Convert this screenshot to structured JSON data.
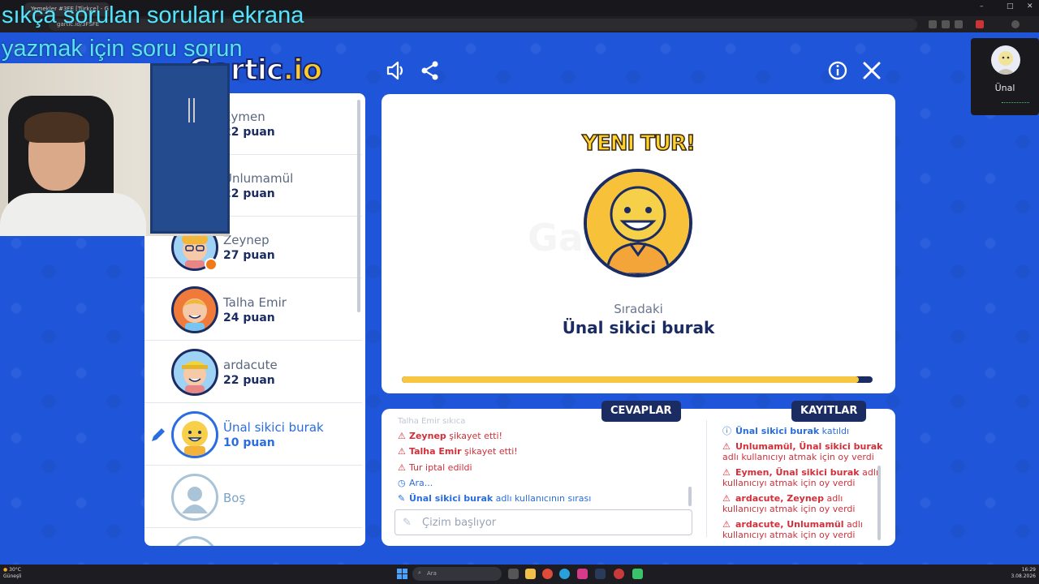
{
  "browser": {
    "tab_title": "Yemekler #3FE [Türkçe] - G",
    "address": "gartic.io/3FSFE"
  },
  "overlay": {
    "line1": "sıkça sorulan soruları ekrana",
    "line2": "yazmak  için soru sorun"
  },
  "logo": {
    "main": "Gartic",
    "suffix": ".io"
  },
  "players": [
    {
      "name": "Eymen",
      "score": "22 puan",
      "state": "normal"
    },
    {
      "name": "Unlumamül",
      "score": "22 puan",
      "state": "normal"
    },
    {
      "name": "Zeynep",
      "score": "27 puan",
      "state": "normal"
    },
    {
      "name": "Talha Emir",
      "score": "24 puan",
      "state": "normal"
    },
    {
      "name": "ardacute",
      "score": "22 puan",
      "state": "normal"
    },
    {
      "name": "Ünal sikici burak",
      "score": "10 puan",
      "state": "active"
    },
    {
      "name": "Boş",
      "score": "",
      "state": "empty"
    }
  ],
  "round": {
    "banner": "YENI TUR!",
    "next_label": "Sıradaki",
    "next_player": "Ünal sikici burak",
    "progress": 0.97
  },
  "tabs": {
    "answers": "CEVAPLAR",
    "logs": "KAYITLAR"
  },
  "answers": {
    "partial_top": "Talha Emir sıkıca",
    "messages": [
      {
        "icon": "warning-icon",
        "who": "Zeynep",
        "text": " şikayet etti!",
        "color": "red"
      },
      {
        "icon": "warning-icon",
        "who": "Talha Emir",
        "text": " şikayet etti!",
        "color": "red"
      },
      {
        "icon": "warning-icon",
        "who": "",
        "text": "Tur iptal edildi",
        "color": "red"
      },
      {
        "icon": "clock-icon",
        "who": "",
        "text": "Ara...",
        "color": "blue"
      },
      {
        "icon": "pencil-icon",
        "who": "Ünal sikici burak",
        "text": " adlı kullanıcının sırası",
        "color": "blue"
      }
    ],
    "input_placeholder": "Çizim başlıyor"
  },
  "logs": [
    {
      "icon": "info-icon",
      "who": "Ünal sikici burak",
      "text": " katıldı",
      "line2": "",
      "color": "blue"
    },
    {
      "icon": "warning-icon",
      "who": "Unlumamül, Ünal sikici burak",
      "text": "",
      "line2": "adlı kullanıcıyı atmak için oy verdi",
      "color": "red"
    },
    {
      "icon": "warning-icon",
      "who": "Eymen, Ünal sikici burak",
      "text": " adlı",
      "line2": "kullanıcıyı atmak için oy verdi",
      "color": "red"
    },
    {
      "icon": "warning-icon",
      "who": "ardacute, Zeynep",
      "text": " adlı",
      "line2": "kullanıcıyı atmak için oy verdi",
      "color": "red"
    },
    {
      "icon": "warning-icon",
      "who": "ardacute, Unlumamül",
      "text": " adlı",
      "line2": "kullanıcıyı atmak için oy verdi",
      "color": "red"
    }
  ],
  "usercard": {
    "name": "Ünal"
  },
  "taskbar": {
    "weather_temp": "30°C",
    "weather_desc": "Güneşli",
    "search": "Ara",
    "time": "16:29",
    "date": "3.08.2026"
  },
  "colors": {
    "navy": "#1b2c63",
    "blue_accent": "#2a6de0",
    "red_text": "#d0303a",
    "bg_blue": "#1f55d9",
    "yellow": "#ffd22e"
  }
}
